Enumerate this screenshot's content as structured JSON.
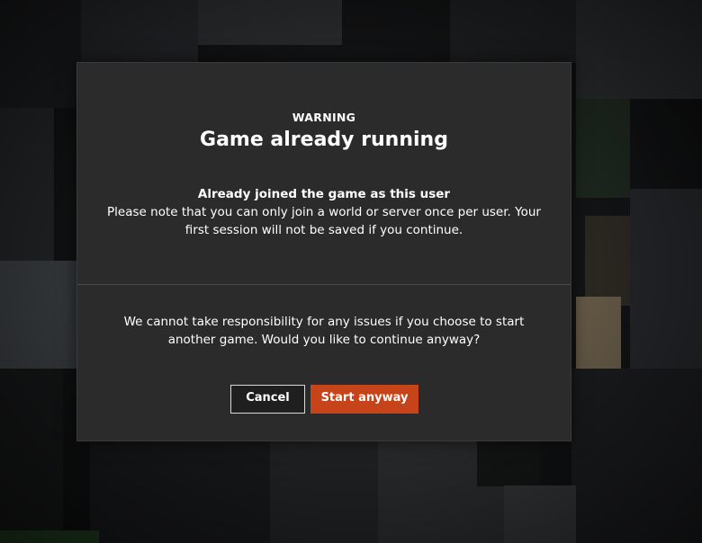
{
  "dialog": {
    "eyebrow": "WARNING",
    "title": "Game already running",
    "notice_heading": "Already joined the game as this user",
    "notice_body": "Please note that you can only join a world or server once per user. Your first session will not be saved if you continue.",
    "disclaimer": "We cannot take responsibility for any issues if you choose to start another game. Would you like to continue anyway?",
    "cancel_label": "Cancel",
    "confirm_label": "Start anyway"
  },
  "colors": {
    "dialog_background": "#2b2b2b",
    "confirm_button": "#c7441a",
    "cancel_button_border": "#d9d9d9",
    "text": "#ffffff"
  }
}
